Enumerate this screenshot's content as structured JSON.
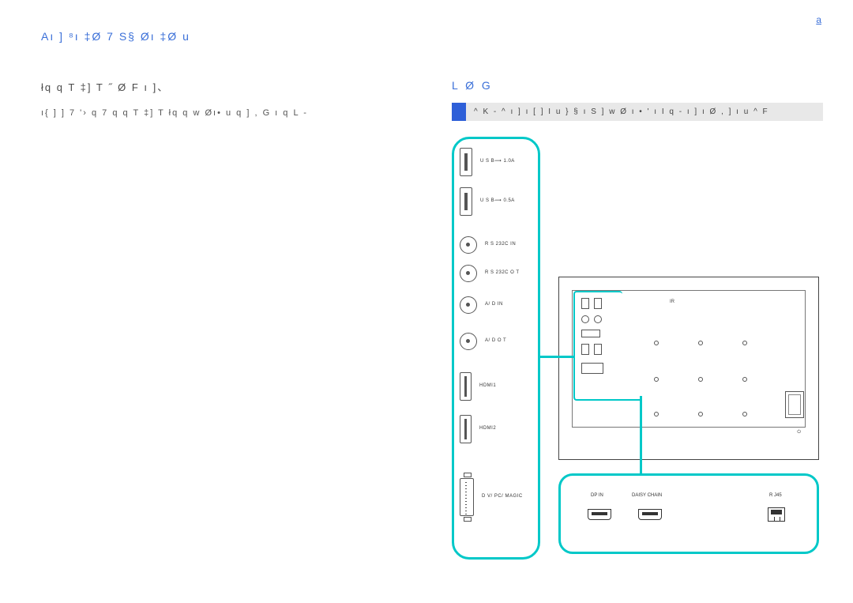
{
  "header": {
    "chapter": "Aı  ]  ⁸ı ‡Ø 7 S§ Øı ‡Ø u",
    "page": "a"
  },
  "left": {
    "title": "łq  q  T ‡]     T ˝ Ø  F   ı ]、",
    "body": "ı{ ]    ]  7   '› q 7 q  q  T ‡]     T   łq  q    w Øı• u q ]   , G  ı q L   -"
  },
  "right": {
    "title": "L Ø    G",
    "note": "^     K  - ^  ı  ] ı   [ ]     I   u }  § ı S ]    w Ø ı • ' ı I     q  -    ı  ] ı Ø ,  ] ı  u ^ F"
  },
  "ports": {
    "usb1": "U S B⟿\n1.0A",
    "usb2": "U S B⟿\n0.5A",
    "rs_in": "R S 232C\nIN",
    "rs_out": "R S 232C\nO  T",
    "aud_in": "A/ D\nIN",
    "aud_out": "A/ D\nO  T",
    "hdmi1": "HDMI1",
    "hdmi2": "HDMI2",
    "dvi": "D V/ PC/\nMAGIC"
  },
  "bottom": {
    "dp_in": "DP IN",
    "dp_chain": "DAISY CHAIN",
    "rj45": "R J45"
  },
  "monitor": {
    "ir_label": "IR"
  }
}
